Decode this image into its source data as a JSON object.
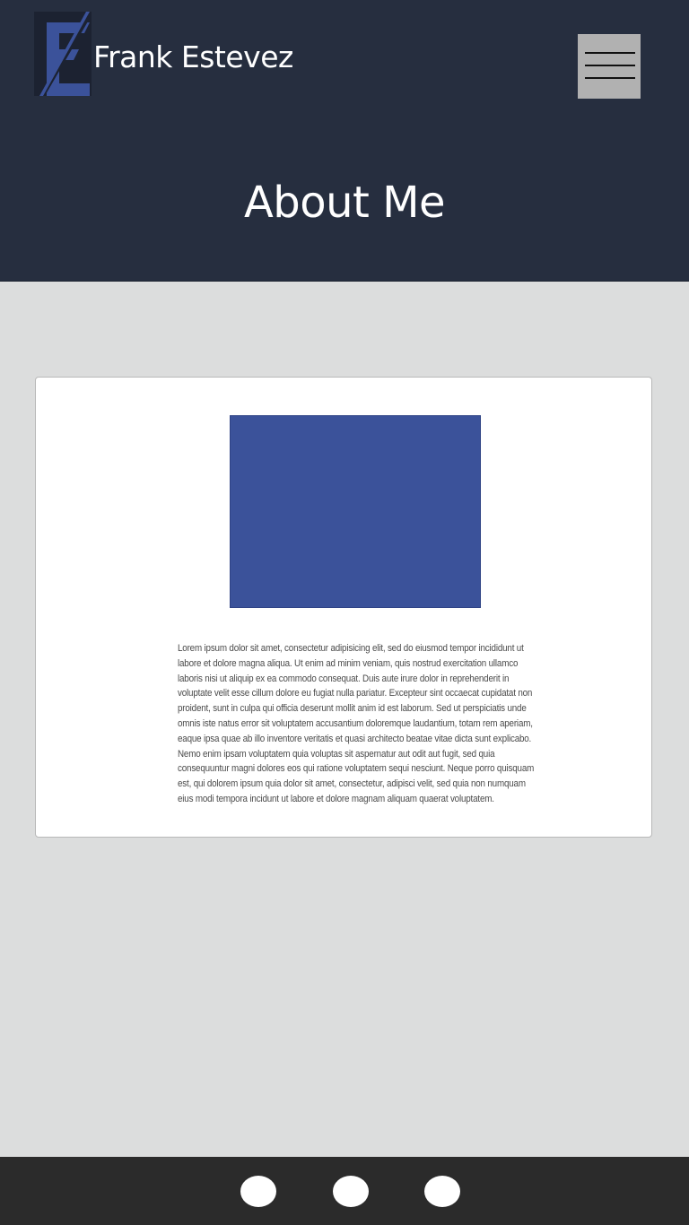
{
  "header": {
    "site_name": "Frank Estevez",
    "page_title": "About Me",
    "logo_icon": "fe-monogram-icon",
    "menu_icon": "hamburger-menu-icon"
  },
  "about": {
    "photo_placeholder_color": "#3b529a",
    "bio": "Lorem ipsum dolor sit amet, consectetur adipisicing elit, sed do eiusmod tempor incididunt ut labore et dolore magna aliqua. Ut enim ad minim veniam, quis nostrud exercitation ullamco laboris nisi ut aliquip ex ea commodo consequat. Duis aute irure dolor in reprehenderit in voluptate velit esse cillum dolore eu fugiat nulla pariatur. Excepteur sint occaecat cupidatat non proident, sunt in culpa qui officia deserunt mollit anim id est laborum. Sed ut perspiciatis unde omnis iste natus error sit voluptatem accusantium doloremque laudantium, totam rem aperiam, eaque ipsa quae ab illo inventore veritatis et quasi architecto beatae vitae dicta sunt explicabo. Nemo enim ipsam voluptatem quia voluptas sit aspernatur aut odit aut fugit, sed quia consequuntur magni dolores eos qui ratione voluptatem sequi nesciunt. Neque porro quisquam est, qui dolorem ipsum quia dolor sit amet, consectetur, adipisci velit, sed quia non numquam eius modi tempora incidunt ut labore et dolore magnam aliquam quaerat voluptatem."
  },
  "footer": {
    "social_icons": [
      "social-link-1-icon",
      "social-link-2-icon",
      "social-link-3-icon"
    ]
  },
  "colors": {
    "header_bg": "#262e3f",
    "page_bg": "#dcdddd",
    "accent": "#3b529a",
    "footer_bg": "#2b2b2b",
    "menu_button_bg": "#b1b1b1"
  }
}
